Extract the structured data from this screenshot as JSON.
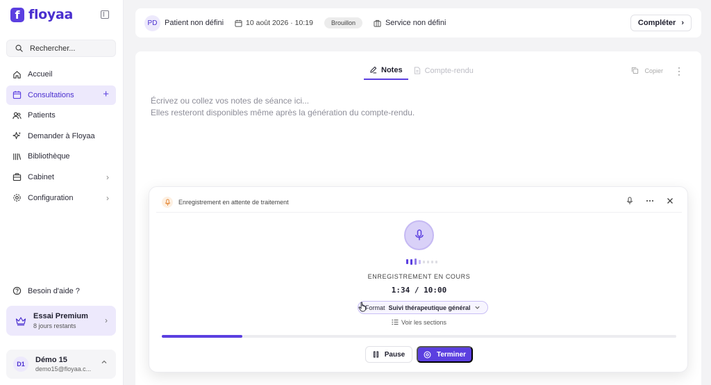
{
  "brand": {
    "name": "floyaa",
    "logo_letter": "f",
    "accent_color": "#5b3fe0"
  },
  "sidebar": {
    "search_placeholder": "Rechercher...",
    "items": [
      {
        "label": "Accueil",
        "icon": "home-icon"
      },
      {
        "label": "Consultations",
        "icon": "calendar-icon",
        "active": true,
        "trailing": "+"
      },
      {
        "label": "Patients",
        "icon": "users-icon"
      },
      {
        "label": "Demander à Floyaa",
        "icon": "sparkles-icon"
      },
      {
        "label": "Bibliothèque",
        "icon": "library-icon"
      },
      {
        "label": "Cabinet",
        "icon": "building-icon",
        "trailing": "›"
      },
      {
        "label": "Configuration",
        "icon": "gear-icon",
        "trailing": "›"
      }
    ],
    "help_label": "Besoin d'aide ?",
    "premium": {
      "title": "Essai Premium",
      "subtitle": "8 jours restants",
      "chevron": "›"
    },
    "user": {
      "initials": "D1",
      "name": "Démo 15",
      "email": "demo15@floyaa.c..."
    }
  },
  "header": {
    "patient_initials": "PD",
    "patient_label": "Patient non défini",
    "date": "10 août 2026 · 10:19",
    "status_badge": "Brouillon",
    "service_label": "Service non défini",
    "complete_label": "Compléter",
    "complete_chevron": "›"
  },
  "editor": {
    "tabs": [
      {
        "label": "Notes",
        "active": true
      },
      {
        "label": "Compte-rendu",
        "active": false
      }
    ],
    "copy_label": "Copier",
    "placeholder_line1": "Écrivez ou collez vos notes de séance ici...",
    "placeholder_line2": "Elles resteront disponibles même après la génération du compte-rendu."
  },
  "recording": {
    "header_title": "Enregistrement en attente de traitement",
    "status_label": "ENREGISTREMENT EN COURS",
    "timer": "1:34 / 10:00",
    "progress_fraction": 0.157,
    "format_prefix": "Format",
    "format_value": "Suivi thérapeutique général",
    "sections_link": "Voir les sections",
    "pause_label": "Pause",
    "finish_label": "Terminer"
  }
}
